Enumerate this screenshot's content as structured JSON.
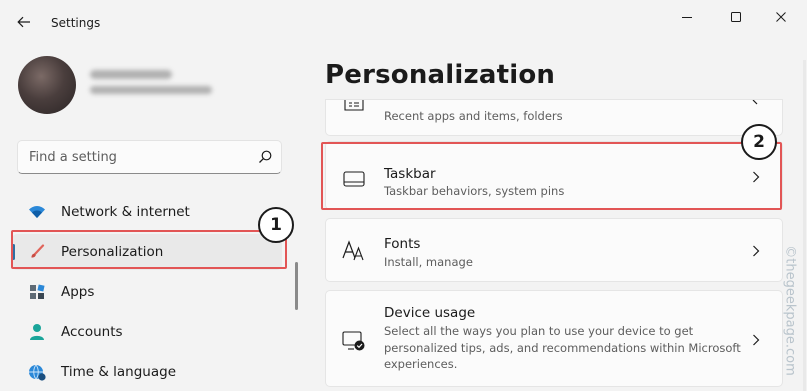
{
  "window": {
    "title": "Settings",
    "controls": [
      "minimize",
      "maximize",
      "close"
    ]
  },
  "search": {
    "placeholder": "Find a setting"
  },
  "sidebar": {
    "items": [
      {
        "label": "Network & internet",
        "icon": "wifi-icon",
        "selected": false
      },
      {
        "label": "Personalization",
        "icon": "brush-icon",
        "selected": true
      },
      {
        "label": "Apps",
        "icon": "apps-icon",
        "selected": false
      },
      {
        "label": "Accounts",
        "icon": "person-icon",
        "selected": false
      },
      {
        "label": "Time & language",
        "icon": "globe-clock-icon",
        "selected": false
      }
    ]
  },
  "main": {
    "title": "Personalization",
    "cards": [
      {
        "title": "",
        "subtitle": "Recent apps and items, folders",
        "icon": "start-menu-icon"
      },
      {
        "title": "Taskbar",
        "subtitle": "Taskbar behaviors, system pins",
        "icon": "taskbar-icon"
      },
      {
        "title": "Fonts",
        "subtitle": "Install, manage",
        "icon": "fonts-icon"
      },
      {
        "title": "Device usage",
        "subtitle_lines": [
          "Select all the ways you plan to use your device to get",
          "personalized tips, ads, and recommendations within Microsoft",
          "experiences."
        ],
        "icon": "device-usage-icon"
      }
    ]
  },
  "annotations": {
    "callout_1": "1",
    "callout_2": "2",
    "highlight_color": "#e25555"
  },
  "colors": {
    "accent": "#2f6fa3",
    "background": "#f3f3f3",
    "card": "#fbfbfb"
  },
  "watermark": "©thegeekpage.com"
}
